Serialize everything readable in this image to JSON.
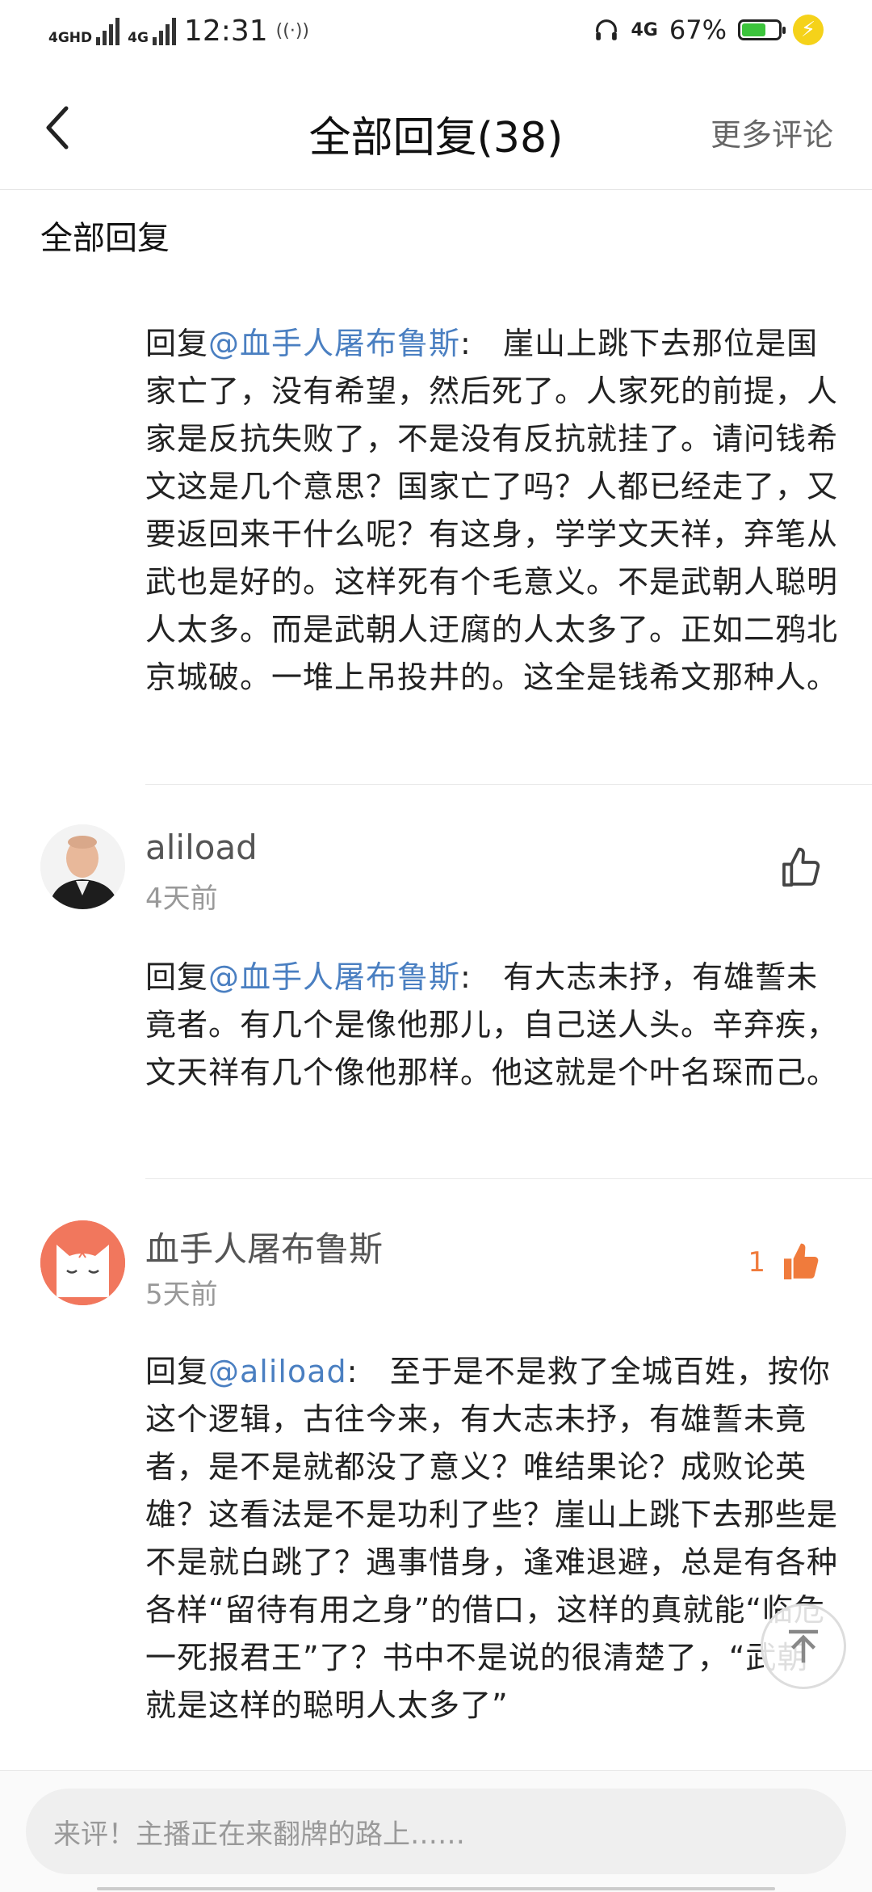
{
  "status": {
    "time": "12:31",
    "net1": "4GHD",
    "net2": "4G",
    "net3": "4G",
    "battery": "67%",
    "battery_level": 0.67
  },
  "header": {
    "title": "全部回复(38)",
    "more": "更多评论"
  },
  "section_title": "全部回复",
  "comments": [
    {
      "prefix": "回复",
      "mention": "@血手人屠布鲁斯",
      "sep": ":",
      "text": "崖山上跳下去那位是国家亡了，没有希望，然后死了。人家死的前提，人家是反抗失败了，不是没有反抗就挂了。请问钱希文这是几个意思？国家亡了吗？人都已经走了，又要返回来干什么呢？有这身，学学文天祥，弃笔从武也是好的。这样死有个毛意义。不是武朝人聪明人太多。而是武朝人迂腐的人太多了。正如二鸦北京城破。一堆上吊投井的。这全是钱希文那种人。"
    },
    {
      "user": "aliload",
      "time": "4天前",
      "likes": "",
      "prefix": "回复",
      "mention": "@血手人屠布鲁斯",
      "sep": ":",
      "text": "有大志未抒，有雄誓未竟者。有几个是像他那儿，自己送人头。辛弃疾，文天祥有几个像他那样。他这就是个叶名琛而己。"
    },
    {
      "user": "血手人屠布鲁斯",
      "time": "5天前",
      "likes": "1",
      "prefix": "回复",
      "mention": "@aliload",
      "sep": ":",
      "text": "至于是不是救了全城百姓，按你这个逻辑，古往今来，有大志未抒，有雄誓未竟者，是不是就都没了意义？唯结果论？成败论英雄？这看法是不是功利了些？崖山上跳下去那些是不是就白跳了？遇事惜身，逢难退避，总是有各种各样“留待有用之身”的借口，这样的真就能“临危一死报君王”了？书中不是说的很清楚了，“武朝就是这样的聪明人太多了”"
    }
  ],
  "input_placeholder": "来评！主播正在来翻牌的路上……",
  "colors": {
    "mention": "#4a7fc1",
    "like_active": "#f07b3c"
  }
}
